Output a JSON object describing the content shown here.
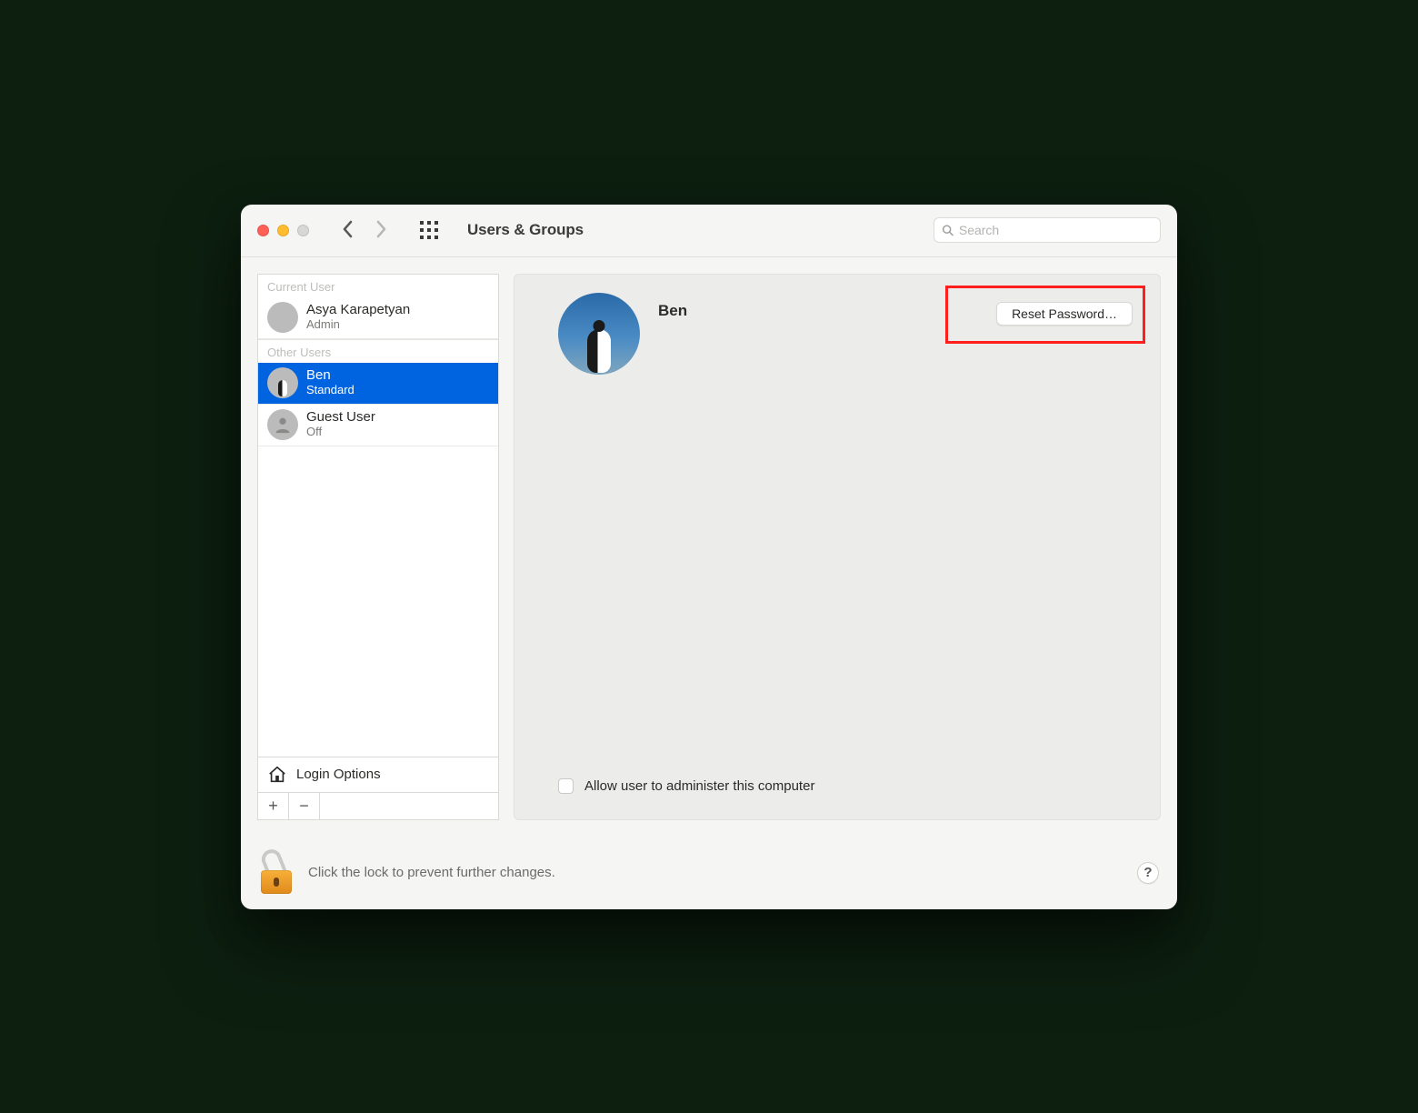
{
  "window": {
    "title": "Users & Groups",
    "search_placeholder": "Search"
  },
  "sidebar": {
    "current_user_header": "Current User",
    "other_users_header": "Other Users",
    "current_user": {
      "name": "Asya Karapetyan",
      "role": "Admin"
    },
    "other_users": [
      {
        "name": "Ben",
        "role": "Standard",
        "selected": true
      },
      {
        "name": "Guest User",
        "role": "Off",
        "selected": false
      }
    ],
    "login_options_label": "Login Options"
  },
  "detail": {
    "name": "Ben",
    "reset_password_label": "Reset Password…",
    "allow_admin_label": "Allow user to administer this computer",
    "allow_admin_checked": false
  },
  "footer": {
    "lock_text": "Click the lock to prevent further changes.",
    "help_label": "?"
  }
}
